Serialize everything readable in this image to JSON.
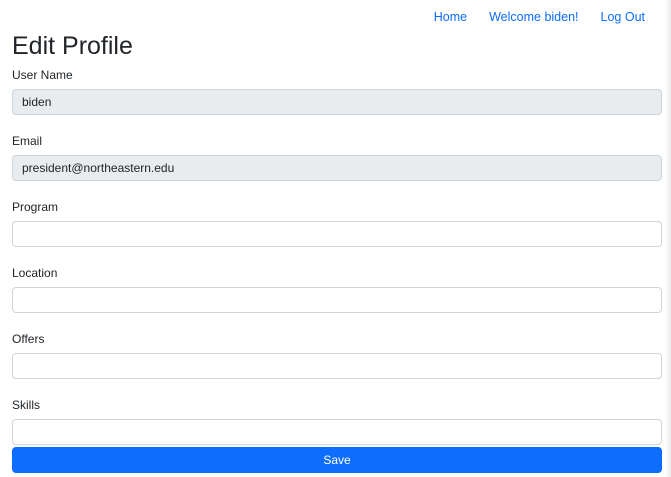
{
  "nav": {
    "home": "Home",
    "welcome": "Welcome biden!",
    "logout": "Log Out"
  },
  "page": {
    "title": "Edit Profile"
  },
  "form": {
    "username": {
      "label": "User Name",
      "value": "biden"
    },
    "email": {
      "label": "Email",
      "value": "president@northeastern.edu"
    },
    "program": {
      "label": "Program",
      "value": ""
    },
    "location": {
      "label": "Location",
      "value": ""
    },
    "offers": {
      "label": "Offers",
      "value": ""
    },
    "skills": {
      "label": "Skills",
      "value": ""
    },
    "save_label": "Save"
  },
  "colors": {
    "accent": "#0d6efd",
    "readonly_bg": "#e9ecef",
    "border": "#ced4da"
  }
}
